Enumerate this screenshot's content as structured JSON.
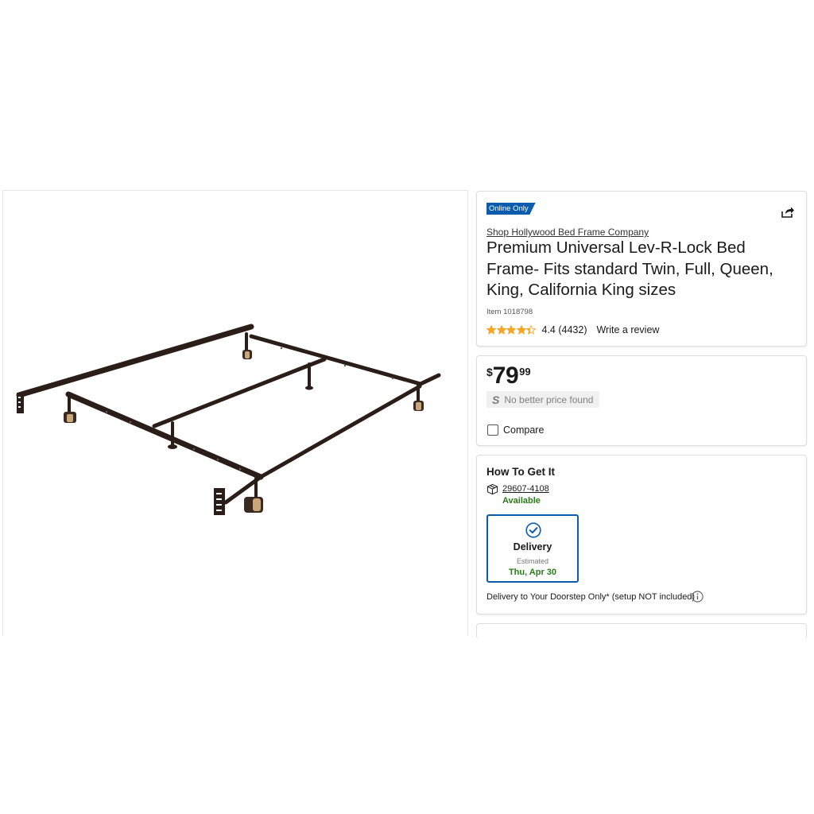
{
  "product_image": {
    "alt": "Premium Universal Lev-R-Lock Bed Frame"
  },
  "info": {
    "badge": "Online Only",
    "brand_link": "Shop Hollywood Bed Frame Company",
    "title": "Premium Universal Lev-R-Lock Bed Frame- Fits standard Twin, Full, Queen, King, California King sizes",
    "item_number": "Item 1018798",
    "rating": {
      "value": 4.4,
      "max": 5,
      "text": "4.4 (4432)"
    },
    "write_review": "Write a review",
    "share_icon": "share-icon"
  },
  "price": {
    "currency": "$",
    "dollars": "79",
    "cents": "99",
    "no_better_icon": "S",
    "no_better_text": "No better price found",
    "compare_label": "Compare",
    "compare_checked": false
  },
  "fulfillment": {
    "heading": "How To Get It",
    "zip": "29607-4108",
    "availability": "Available",
    "option": {
      "label": "Delivery",
      "estimated": "Estimated",
      "date": "Thu, Apr 30",
      "selected": true
    },
    "note": "Delivery to Your Doorstep Only* (setup NOT included)"
  },
  "colors": {
    "accent_blue": "#0b5cad",
    "available_green": "#2a7a18",
    "star_gold": "#f5a623"
  }
}
